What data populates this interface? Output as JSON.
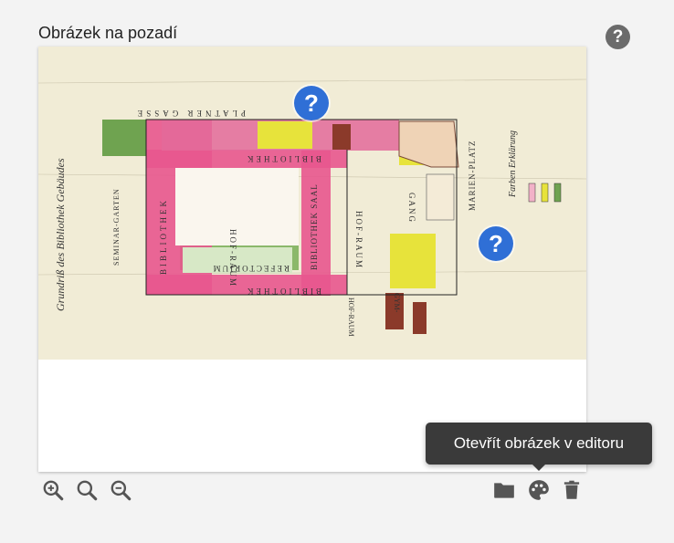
{
  "header": {
    "title": "Obrázek na pozadí",
    "help_icon": "help-circle-icon",
    "help_glyph": "?"
  },
  "image": {
    "hotspots": [
      {
        "glyph": "?"
      },
      {
        "glyph": "?"
      }
    ],
    "labels": {
      "bibliothek_top": "BIBLIOTHEK",
      "bibliothek_left": "BIBLIOTHEK",
      "bibliothek_bottom": "BIBLIOTHEK",
      "bibliothek_saal": "BIBLIOTHEK SAAL",
      "hof_raum": "HOF-RAUM",
      "refectorium": "REFECTORIUM",
      "hof_raum_right": "HOF-RAUM",
      "gang": "GANG",
      "marien_platz": "MARIEN-PLATZ",
      "platner_gasse": "PLATNER GASSE",
      "seminar_garten": "SEMINAR-GARTEN",
      "grundriss": "Grundriß des Bibliothek Gebäudes",
      "farben": "Farben Erklärung",
      "gym": "GYM-",
      "hof_raum_low": "HOF-RAUM"
    }
  },
  "tooltip": {
    "text": "Otevřít obrázek v editoru"
  },
  "toolbar": {
    "zoom_in": "zoom-in-icon",
    "zoom_reset": "zoom-icon",
    "zoom_out": "zoom-out-icon",
    "folder": "folder-icon",
    "palette": "palette-icon",
    "delete": "trash-icon"
  },
  "colors": {
    "accent_blue": "#2f6fd6",
    "map_pink": "#e8578e",
    "map_yellow": "#e7e33b",
    "map_green": "#6fa350",
    "icon_gray": "#555555"
  }
}
